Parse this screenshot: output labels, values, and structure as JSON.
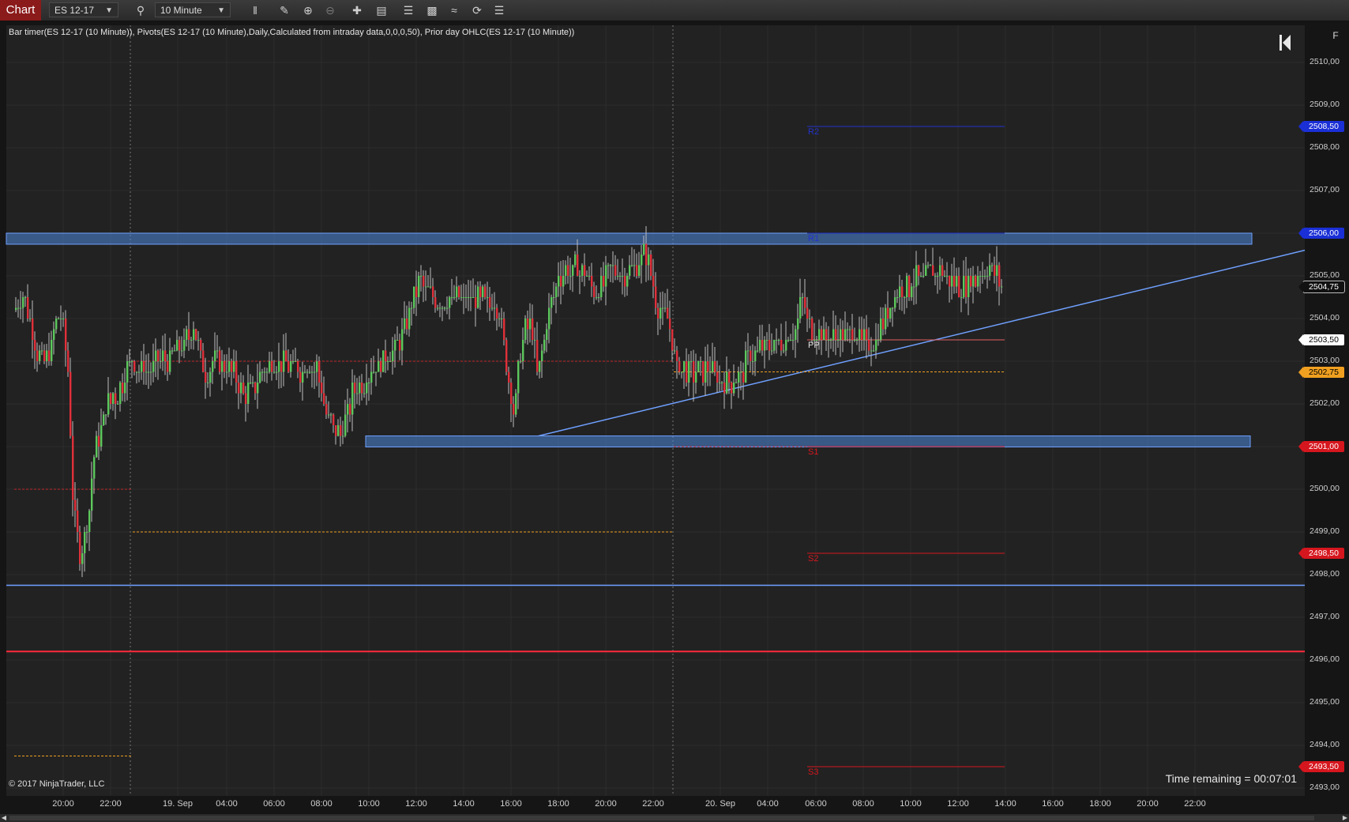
{
  "toolbar": {
    "chart_tab_label": "Chart",
    "instrument": "ES 12-17",
    "interval": "10 Minute",
    "icons": [
      "search-icon",
      "bar-type-icon",
      "pencil-draw-icon",
      "zoom-in-icon",
      "zoom-out-icon",
      "crosshair-icon",
      "properties-icon",
      "data-series-icon",
      "strategies-icon",
      "indicators-icon",
      "refresh-icon",
      "list-icon"
    ]
  },
  "chart": {
    "legend": "Bar timer(ES 12-17 (10 Minute)), Pivots(ES 12-17 (10 Minute),Daily,Calculated from intraday data,0,0,0,50), Prior day OHLC(ES 12-17 (10 Minute))",
    "copyright": "© 2017 NinjaTrader, LLC",
    "time_remaining": "Time remaining = 00:07:01",
    "f_button": "F",
    "pivots": {
      "R2": "R2",
      "R1": "R1",
      "PP": "PP",
      "S1": "S1",
      "S2": "S2",
      "S3": "S3"
    },
    "price_axis": [
      "2510,00",
      "2509,00",
      "2508,00",
      "2507,00",
      "2506,00",
      "2505,00",
      "2504,00",
      "2503,00",
      "2502,00",
      "2501,00",
      "2500,00",
      "2499,00",
      "2498,00",
      "2497,00",
      "2496,00",
      "2495,00",
      "2494,00",
      "2493,00"
    ],
    "price_tags": [
      {
        "label": "2508,50",
        "bg": "#1a2fd6",
        "fg": "#ffffff",
        "price": 2508.5
      },
      {
        "label": "2506,00",
        "bg": "#1a2fd6",
        "fg": "#ffffff",
        "price": 2506.0
      },
      {
        "label": "2504,75",
        "bg": "#111111",
        "fg": "#ffffff",
        "price": 2504.75,
        "border": "#bbbbbb"
      },
      {
        "label": "2503,50",
        "bg": "#ffffff",
        "fg": "#000000",
        "price": 2503.5
      },
      {
        "label": "2502,75",
        "bg": "#f0a020",
        "fg": "#000000",
        "price": 2502.75
      },
      {
        "label": "2501,00",
        "bg": "#d6161e",
        "fg": "#ffffff",
        "price": 2501.0
      },
      {
        "label": "2498,50",
        "bg": "#d6161e",
        "fg": "#ffffff",
        "price": 2498.5
      },
      {
        "label": "2493,50",
        "bg": "#d6161e",
        "fg": "#ffffff",
        "price": 2493.5
      }
    ],
    "time_axis": [
      "20:00",
      "22:00",
      "19. Sep",
      "04:00",
      "06:00",
      "08:00",
      "10:00",
      "12:00",
      "14:00",
      "16:00",
      "18:00",
      "20:00",
      "22:00",
      "20. Sep",
      "04:00",
      "06:00",
      "08:00",
      "10:00",
      "12:00",
      "14:00",
      "16:00",
      "18:00",
      "20:00",
      "22:00"
    ],
    "colors": {
      "up": "#5cc85c",
      "down": "#e0303a",
      "wick": "#d0d0d0",
      "grid": "#2c2c2c",
      "zone": "#4c86d8",
      "trend": "#6fa0ff",
      "support": "#ff2a3a"
    }
  },
  "chart_data": {
    "type": "candlestick",
    "instrument": "ES 12-17",
    "interval": "10 Minute",
    "ylim": [
      2492.8,
      2510.8
    ],
    "horizontal_lines": [
      {
        "price": 2497.75,
        "style": "solid",
        "color": "#6fa0ff"
      },
      {
        "price": 2496.2,
        "style": "solid",
        "color": "#ff2a3a"
      }
    ],
    "zones": [
      {
        "from": 2505.75,
        "to": 2506.0
      },
      {
        "from": 2501.0,
        "to": 2501.25
      }
    ],
    "pivot_levels": {
      "R2": 2508.5,
      "R1": 2506.0,
      "PP": 2503.5,
      "S1": 2501.0,
      "S2": 2498.5,
      "S3": 2493.5
    },
    "prior_day": {
      "close_line": 2502.75,
      "open_line": 2499.0,
      "prior_close": 2500.0,
      "prior_low": 2493.75
    },
    "last_price": 2504.75
  }
}
